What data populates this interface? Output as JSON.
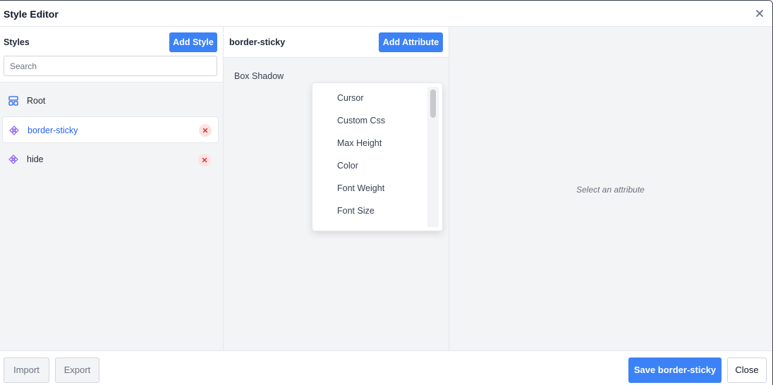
{
  "dialog": {
    "title": "Style Editor",
    "close_icon": "close-icon"
  },
  "styles_panel": {
    "label": "Styles",
    "add_button": "Add Style",
    "search_placeholder": "Search",
    "items": [
      {
        "name": "Root",
        "icon": "layout-icon",
        "deletable": false,
        "selected": false
      },
      {
        "name": "border-sticky",
        "icon": "component-icon",
        "deletable": true,
        "selected": true
      },
      {
        "name": "hide",
        "icon": "component-icon",
        "deletable": true,
        "selected": false
      }
    ]
  },
  "attributes_panel": {
    "style_name": "border-sticky",
    "add_button": "Add Attribute",
    "items": [
      "Box Shadow"
    ]
  },
  "attribute_dropdown": {
    "options": [
      "Cursor",
      "Custom Css",
      "Max Height",
      "Color",
      "Font Weight",
      "Font Size"
    ]
  },
  "detail_panel": {
    "placeholder": "Select an attribute"
  },
  "footer": {
    "import_label": "Import",
    "export_label": "Export",
    "save_label": "Save border-sticky",
    "close_label": "Close"
  },
  "colors": {
    "primary": "#3b82f6",
    "selected_text": "#2563eb",
    "delete_bg": "#fde2e2",
    "delete_icon": "#dc2626",
    "component_icon": "#8b5cf6",
    "layout_icon": "#2563eb"
  }
}
